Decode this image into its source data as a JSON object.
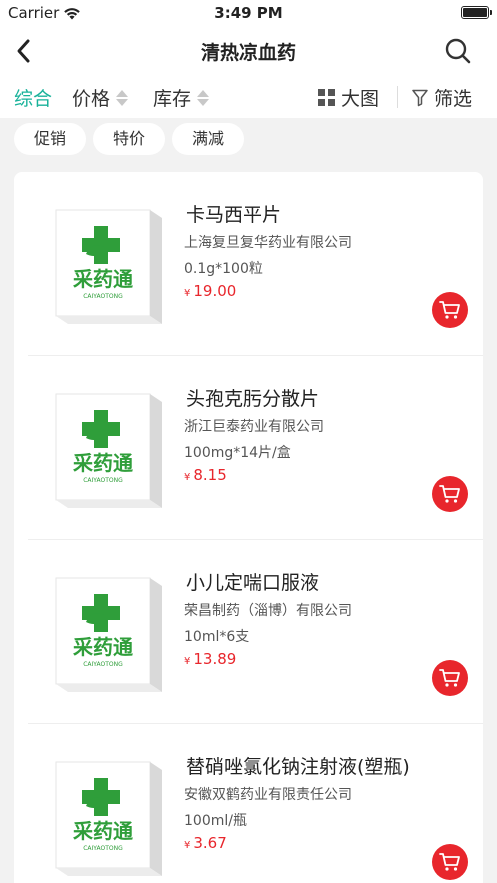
{
  "status_bar": {
    "carrier": "Carrier",
    "time": "3:49 PM"
  },
  "nav": {
    "title": "清热凉血药",
    "back_icon": "chevron-left-icon",
    "search_icon": "search-icon"
  },
  "filters": {
    "sort_comprehensive": "综合",
    "sort_price": "价格",
    "sort_stock": "库存",
    "view_toggle": "大图",
    "filter": "筛选",
    "active_color": "#19b29a"
  },
  "tags": [
    "促销",
    "特价",
    "满减"
  ],
  "products": [
    {
      "name": "卡马西平片",
      "manufacturer": "上海复旦复华药业有限公司",
      "spec": "0.1g*100粒",
      "currency": "¥",
      "price": "19.00"
    },
    {
      "name": "头孢克肟分散片",
      "manufacturer": "浙江巨泰药业有限公司",
      "spec": "100mg*14片/盒",
      "currency": "¥",
      "price": "8.15"
    },
    {
      "name": "小儿定喘口服液",
      "manufacturer": "荣昌制药（淄博）有限公司",
      "spec": "10ml*6支",
      "currency": "¥",
      "price": "13.89"
    },
    {
      "name": "替硝唑氯化钠注射液(塑瓶)",
      "manufacturer": "安徽双鹤药业有限责任公司",
      "spec": "100ml/瓶",
      "currency": "¥",
      "price": "3.67"
    }
  ],
  "product_logo": {
    "brand_cn": "采药通",
    "brand_en": "CAIYAOTONG"
  },
  "colors": {
    "price": "#e8262c",
    "cart_button": "#e8262c",
    "logo_green": "#2f9e3a"
  }
}
